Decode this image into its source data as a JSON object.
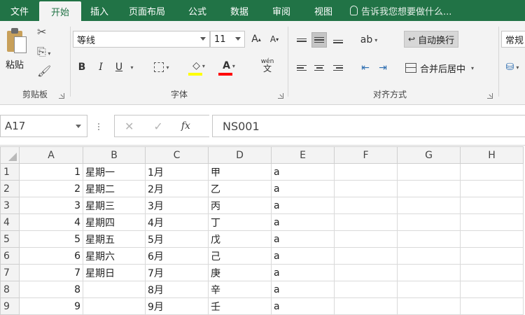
{
  "menu": {
    "tabs": [
      {
        "label": "文件"
      },
      {
        "label": "开始"
      },
      {
        "label": "插入"
      },
      {
        "label": "页面布局"
      },
      {
        "label": "公式"
      },
      {
        "label": "数据"
      },
      {
        "label": "审阅"
      },
      {
        "label": "视图"
      }
    ],
    "tell_me": "告诉我您想要做什么..."
  },
  "ribbon": {
    "clipboard": {
      "paste_label": "粘贴",
      "group_label": "剪贴板"
    },
    "font": {
      "font_name": "等线",
      "font_size": "11",
      "bold": "B",
      "italic": "I",
      "underline": "U",
      "phonetic": "wén",
      "group_label": "字体",
      "fill_color": "#ffff00",
      "font_color": "#ff0000"
    },
    "alignment": {
      "wrap_text": "自动换行",
      "merge_center": "合并后居中",
      "group_label": "对齐方式"
    },
    "number": {
      "format": "常规"
    }
  },
  "formula_bar": {
    "name_box": "A17",
    "fx": "fx",
    "value": "NS001"
  },
  "sheet": {
    "columns": [
      "A",
      "B",
      "C",
      "D",
      "E",
      "F",
      "G",
      "H"
    ],
    "rows": [
      {
        "n": "1",
        "A": "1",
        "B": "星期一",
        "C": "1月",
        "D": "甲",
        "E": "a"
      },
      {
        "n": "2",
        "A": "2",
        "B": "星期二",
        "C": "2月",
        "D": "乙",
        "E": "a"
      },
      {
        "n": "3",
        "A": "3",
        "B": "星期三",
        "C": "3月",
        "D": "丙",
        "E": "a"
      },
      {
        "n": "4",
        "A": "4",
        "B": "星期四",
        "C": "4月",
        "D": "丁",
        "E": "a"
      },
      {
        "n": "5",
        "A": "5",
        "B": "星期五",
        "C": "5月",
        "D": "戊",
        "E": "a"
      },
      {
        "n": "6",
        "A": "6",
        "B": "星期六",
        "C": "6月",
        "D": "己",
        "E": "a"
      },
      {
        "n": "7",
        "A": "7",
        "B": "星期日",
        "C": "7月",
        "D": "庚",
        "E": "a"
      },
      {
        "n": "8",
        "A": "8",
        "B": "",
        "C": "8月",
        "D": "辛",
        "E": "a"
      },
      {
        "n": "9",
        "A": "9",
        "B": "",
        "C": "9月",
        "D": "壬",
        "E": "a"
      }
    ]
  },
  "colors": {
    "excel_green": "#217346",
    "ribbon_bg": "#f3f3f3",
    "gridline": "#dadada"
  }
}
